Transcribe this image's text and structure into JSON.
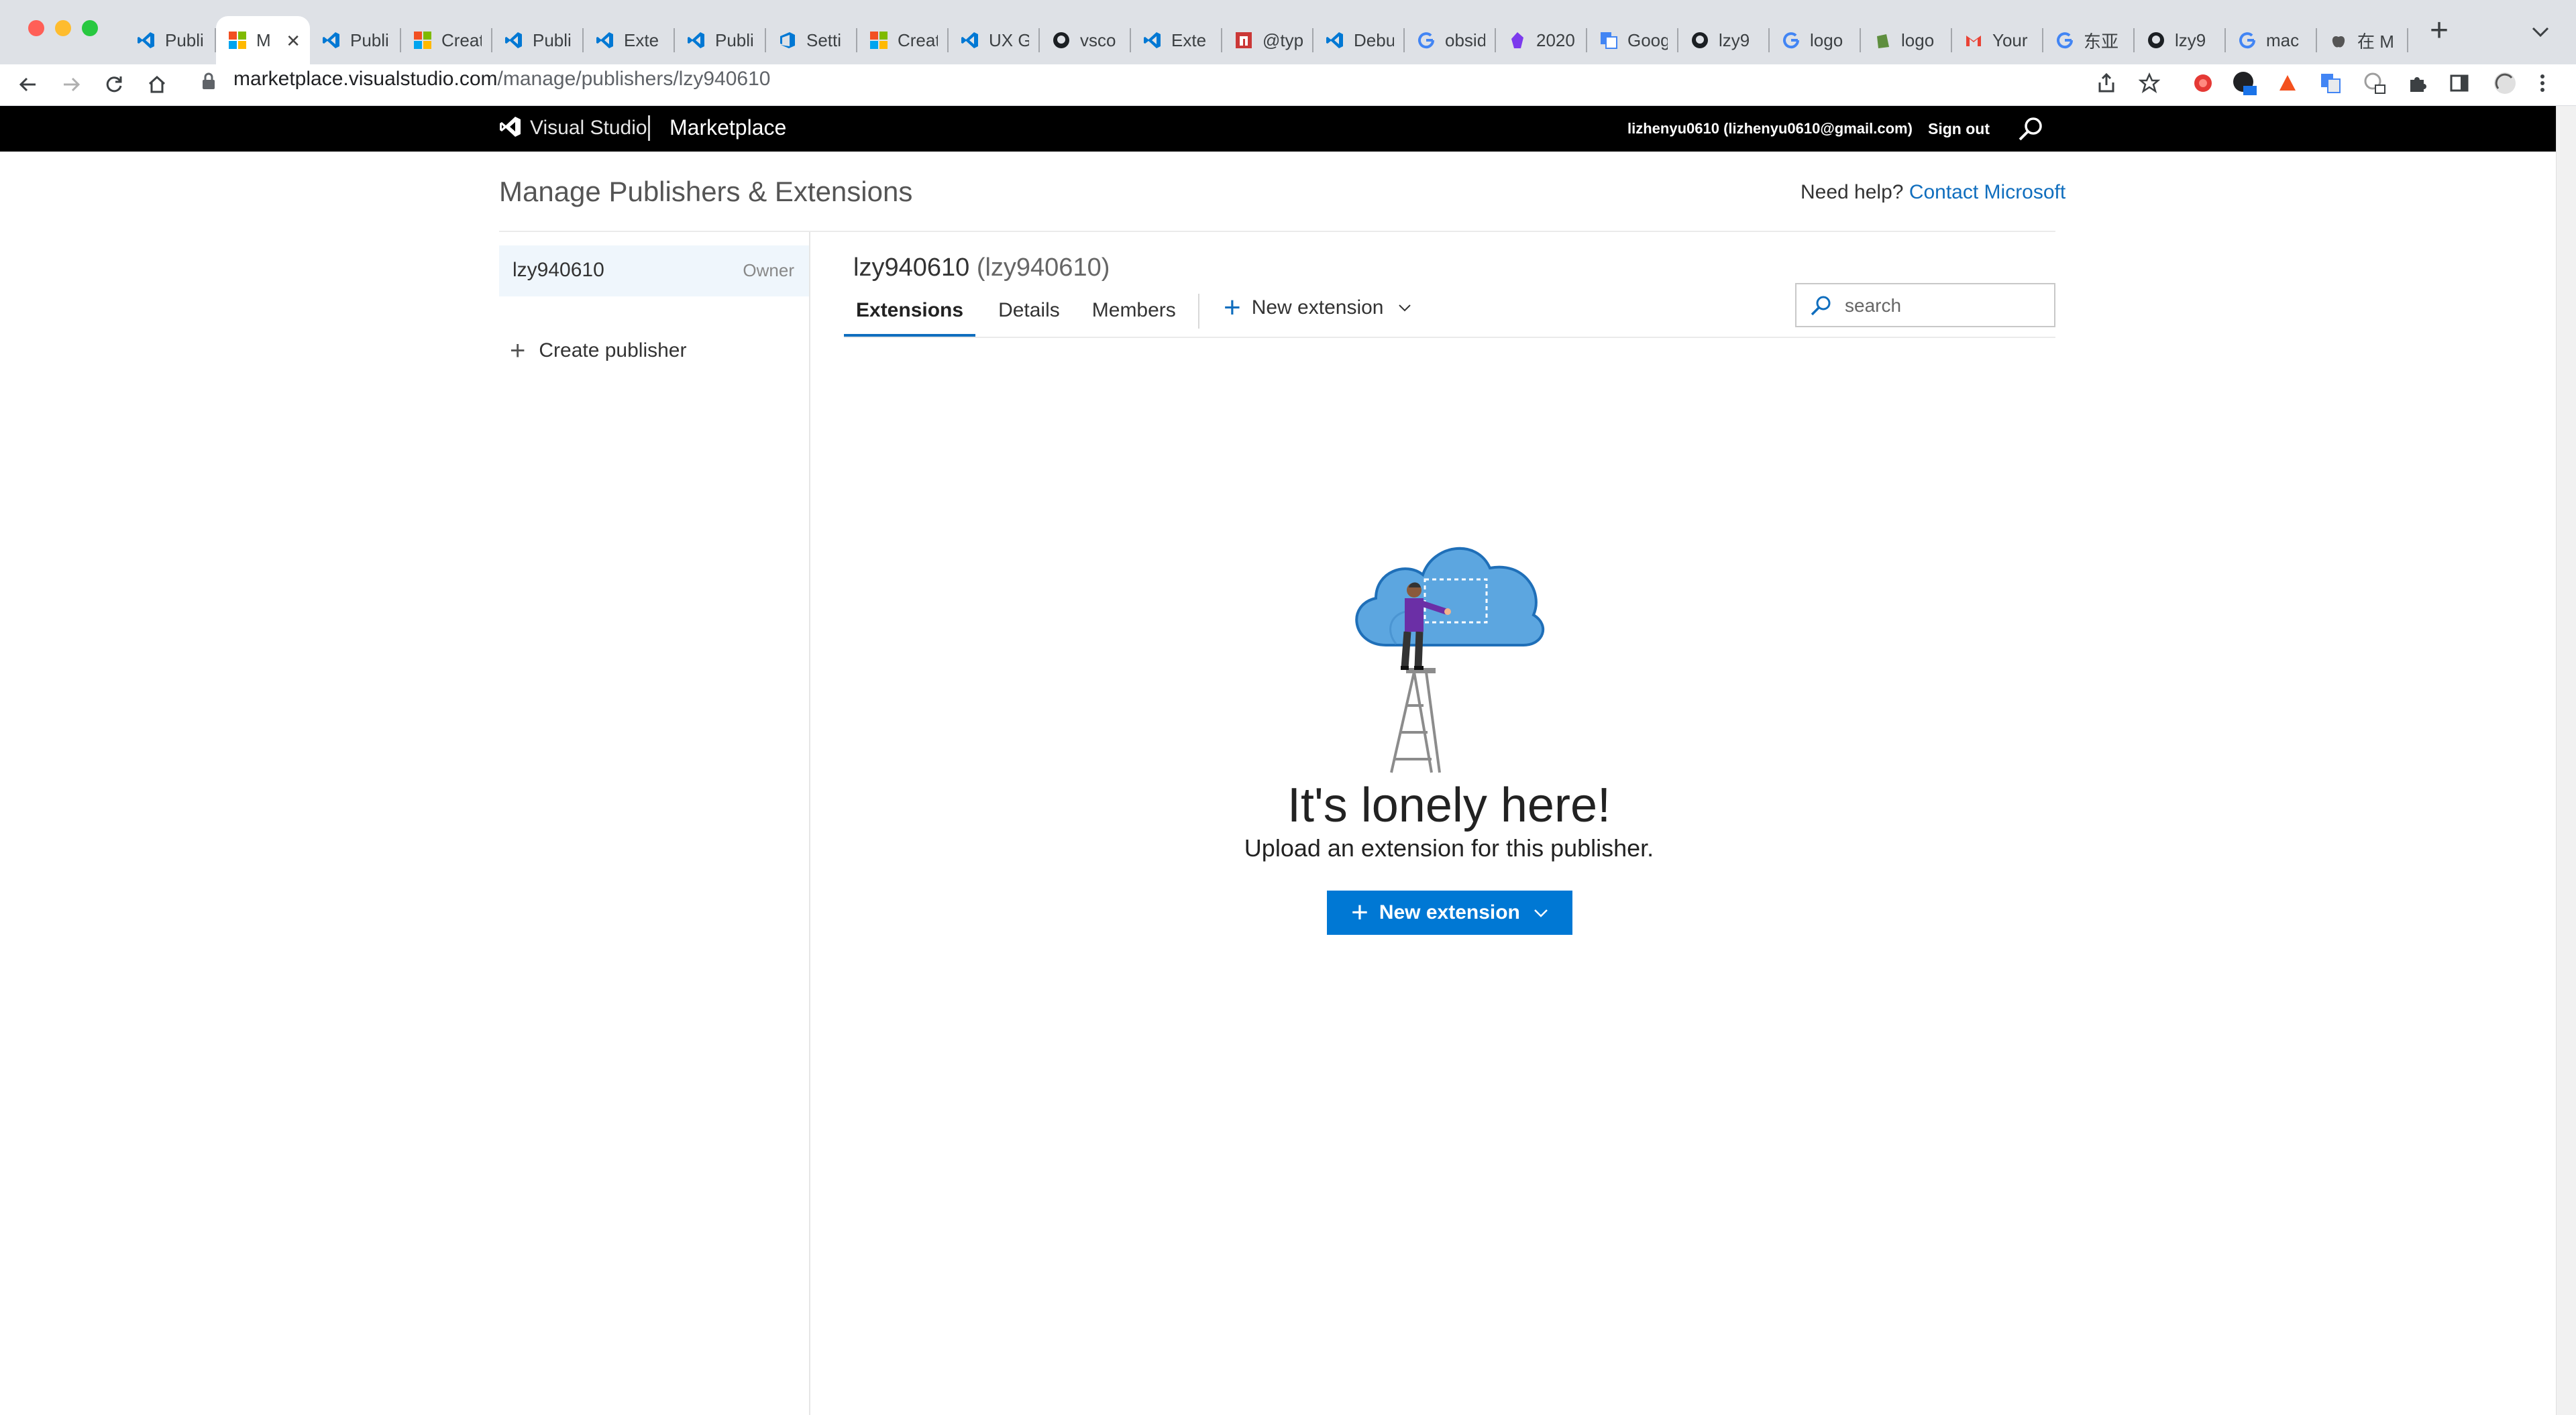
{
  "browser": {
    "tabs": [
      {
        "title": "Publi",
        "icon": "vscode-icon"
      },
      {
        "title": "M",
        "icon": "microsoft-icon",
        "active": true
      },
      {
        "title": "Publi",
        "icon": "vscode-icon"
      },
      {
        "title": "Creat",
        "icon": "microsoft-icon"
      },
      {
        "title": "Publi",
        "icon": "vscode-icon"
      },
      {
        "title": "Exte",
        "icon": "vscode-icon"
      },
      {
        "title": "Publi",
        "icon": "vscode-icon"
      },
      {
        "title": "Setti",
        "icon": "azure-devops-icon"
      },
      {
        "title": "Creat",
        "icon": "microsoft-icon"
      },
      {
        "title": "UX G",
        "icon": "vscode-icon"
      },
      {
        "title": "vsco",
        "icon": "github-icon"
      },
      {
        "title": "Exte",
        "icon": "vscode-icon"
      },
      {
        "title": "@typ",
        "icon": "npm-icon"
      },
      {
        "title": "Debu",
        "icon": "vscode-icon"
      },
      {
        "title": "obsid",
        "icon": "google-icon"
      },
      {
        "title": "2020",
        "icon": "obsidian-icon"
      },
      {
        "title": "Goog",
        "icon": "google-translate-icon"
      },
      {
        "title": "lzy9",
        "icon": "github-icon"
      },
      {
        "title": "logo",
        "icon": "google-icon"
      },
      {
        "title": "logo",
        "icon": "shopify-icon"
      },
      {
        "title": "Your",
        "icon": "gmail-icon"
      },
      {
        "title": "东亚",
        "icon": "google-icon"
      },
      {
        "title": "lzy9",
        "icon": "github-icon"
      },
      {
        "title": "mac",
        "icon": "google-icon"
      },
      {
        "title": "在 M",
        "icon": "apple-icon"
      }
    ],
    "url_domain": "marketplace.visualstudio.com",
    "url_path": "/manage/publishers/lzy940610"
  },
  "header": {
    "brand": "Visual Studio",
    "section": "Marketplace",
    "account": "lizhenyu0610 (lizhenyu0610@gmail.com)",
    "sign_out": "Sign out"
  },
  "page": {
    "title": "Manage Publishers & Extensions",
    "help_prefix": "Need help?",
    "help_link": "Contact Microsoft"
  },
  "sidebar": {
    "publisher_name": "lzy940610",
    "publisher_role": "Owner",
    "create_publisher": "Create publisher"
  },
  "publisher": {
    "name": "lzy940610",
    "id_paren": "(lzy940610)",
    "tabs": [
      "Extensions",
      "Details",
      "Members"
    ],
    "active_tab": "Extensions",
    "new_extension": "New extension",
    "search_placeholder": "search"
  },
  "empty_state": {
    "title": "It's lonely here!",
    "subtitle": "Upload an extension for this publisher.",
    "button": "New extension"
  },
  "colors": {
    "accent": "#0078d4",
    "link": "#106ebe",
    "header_bg": "#000000"
  }
}
